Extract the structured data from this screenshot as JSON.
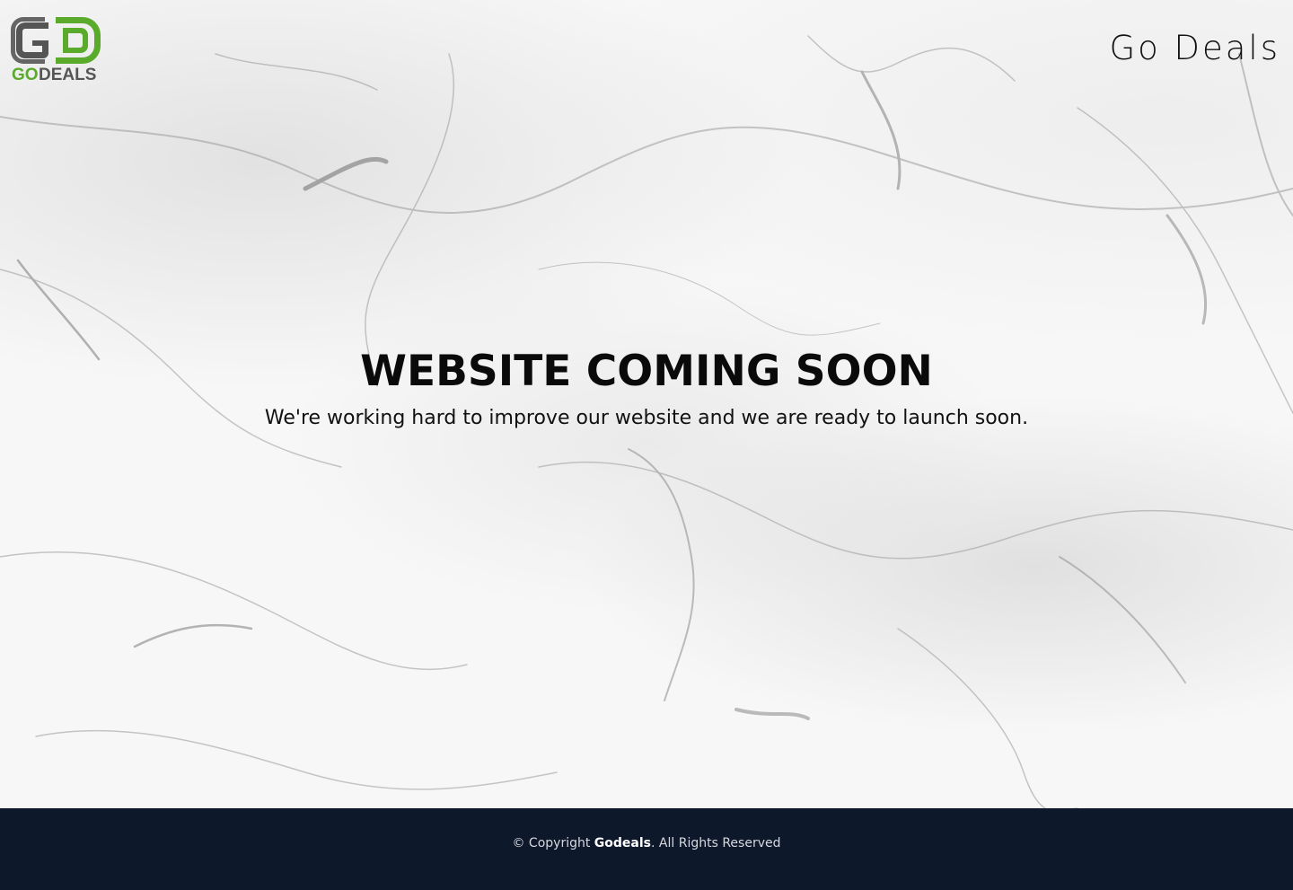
{
  "header": {
    "logo_text_go": "GO",
    "logo_text_deals": "DEALS",
    "logo_letters": "GD",
    "brand_name": "Go Deals"
  },
  "main": {
    "headline": "WEBSITE COMING SOON",
    "subline": "We're working hard to improve our website and we are ready to launch soon."
  },
  "footer": {
    "copyright_prefix": "© Copyright",
    "company": "Godeals",
    "suffix": ". All Rights Reserved"
  },
  "colors": {
    "logo_green": "#5aab2c",
    "logo_gray": "#555555",
    "footer_bg": "#0e182b",
    "text_dark": "#0a0a0a"
  },
  "icons": {
    "logo": "godeals-logo"
  }
}
